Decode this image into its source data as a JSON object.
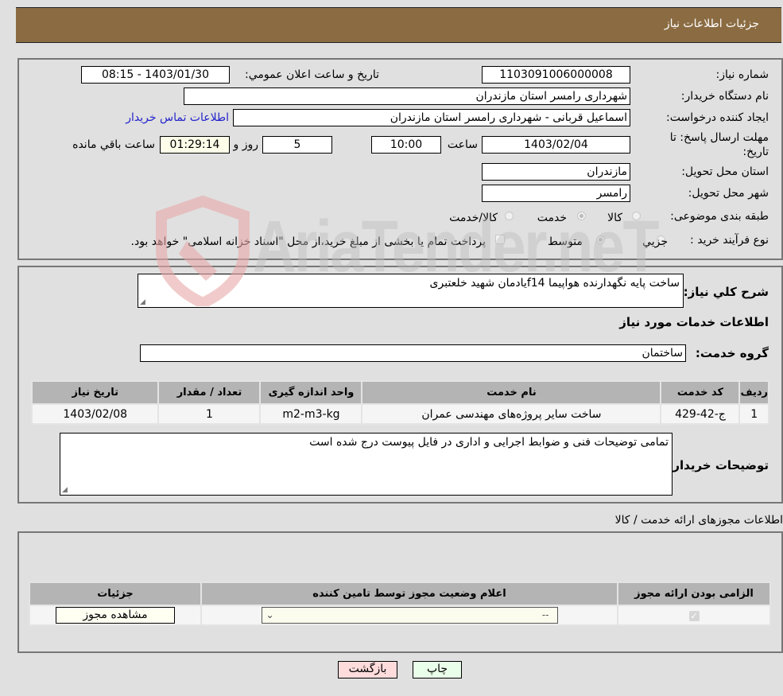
{
  "header": {
    "title": "جزئیات اطلاعات نیاز"
  },
  "form": {
    "need_number": {
      "label": "شماره نیاز:",
      "value": "1103091006000008"
    },
    "announce_datetime": {
      "label": "تاریخ و ساعت اعلان عمومي:",
      "value": "1403/01/30 - 08:15"
    },
    "buyer_org": {
      "label": "نام دستگاه خريدار:",
      "value": "شهرداری رامسر استان مازندران"
    },
    "requester": {
      "label": "ایجاد کننده درخواست:",
      "value": "اسماعیل قربانی - شهرداری رامسر استان مازندران"
    },
    "contact_link": "اطلاعات تماس خريدار",
    "deadline": {
      "label": "مهلت ارسال پاسخ: تا تاریخ:",
      "date": "1403/02/04",
      "time_label": "ساعت",
      "time": "10:00",
      "days": "5",
      "days_label": "روز و",
      "remaining": "01:29:14",
      "remaining_label": "ساعت باقي مانده"
    },
    "delivery_province": {
      "label": "استان محل تحویل:",
      "value": "مازندران"
    },
    "delivery_city": {
      "label": "شهر محل تحویل:",
      "value": "رامسر"
    },
    "category": {
      "label": "طبقه بندی موضوعی:",
      "options": [
        "کالا",
        "خدمت",
        "کالا/خدمت"
      ],
      "selected": "خدمت"
    },
    "purchase_process": {
      "label": "نوع فرآیند خرید :",
      "options": [
        "جزيي",
        "متوسط"
      ],
      "selected": "متوسط",
      "treasury_note": "پرداخت تمام یا بخشی از مبلغ خرید،از محل \"اسناد خزانه اسلامی\" خواهد بود."
    }
  },
  "details": {
    "summary_label": "شرح كلي نياز:",
    "summary_value": "ساخت پایه نگهدارنده هواپیما f14یادمان شهید خلعتبری",
    "services_title": "اطلاعات خدمات مورد نياز",
    "service_group_label": "گروه خدمت:",
    "service_group_value": "ساختمان",
    "table": {
      "headers": [
        "رديف",
        "كد خدمت",
        "نام خدمت",
        "واحد اندازه گيری",
        "تعداد / مقدار",
        "تاريخ نياز"
      ],
      "rows": [
        [
          "1",
          "ج-42-429",
          "ساخت سایر پروژه‌های مهندسی عمران",
          "m2-m3-kg",
          "1",
          "1403/02/08"
        ]
      ]
    },
    "buyer_notes_label": "توضيحات خريدار:",
    "buyer_notes_value": "تمامی توضیحات فنی و ضوابط اجرایی و اداری در فایل پیوست درج شده است"
  },
  "permits": {
    "title": "اطلاعات مجوزهای ارائه خدمت / کالا",
    "headers": [
      "الزامی بودن ارائه مجوز",
      "اعلام وضعیت مجوز توسط تامین کننده",
      "جزئیات"
    ],
    "row": {
      "required_checked": true,
      "status_selected": "--",
      "details_button": "مشاهده مجوز"
    }
  },
  "actions": {
    "print": "چاپ",
    "back": "بازگشت"
  },
  "watermark": {
    "text": "AriaTender.neT"
  },
  "colors": {
    "header_bg": "#8b6c42",
    "print_bg": "#eaffea",
    "back_bg": "#ffdcdc",
    "link": "#2222cc"
  }
}
